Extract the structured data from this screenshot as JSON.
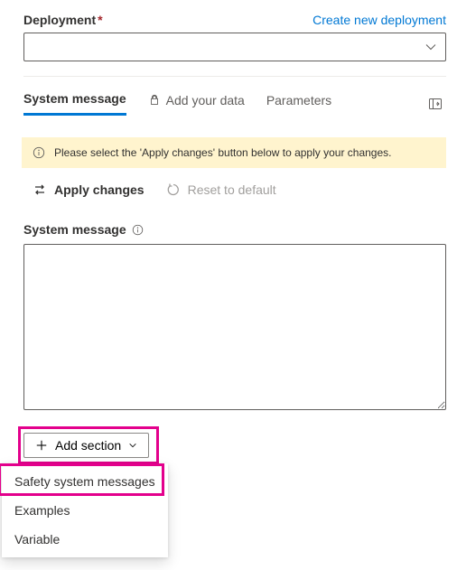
{
  "header": {
    "deployment_label": "Deployment",
    "create_link": "Create new deployment"
  },
  "tabs": {
    "system": "System message",
    "add_data": "Add your data",
    "parameters": "Parameters"
  },
  "notice": "Please select the 'Apply changes' button below to apply your changes.",
  "actions": {
    "apply": "Apply changes",
    "reset": "Reset to default"
  },
  "system_section": {
    "label": "System message",
    "value": ""
  },
  "add_section": {
    "button": "Add section",
    "menu": {
      "safety": "Safety system messages",
      "examples": "Examples",
      "variable": "Variable"
    }
  }
}
